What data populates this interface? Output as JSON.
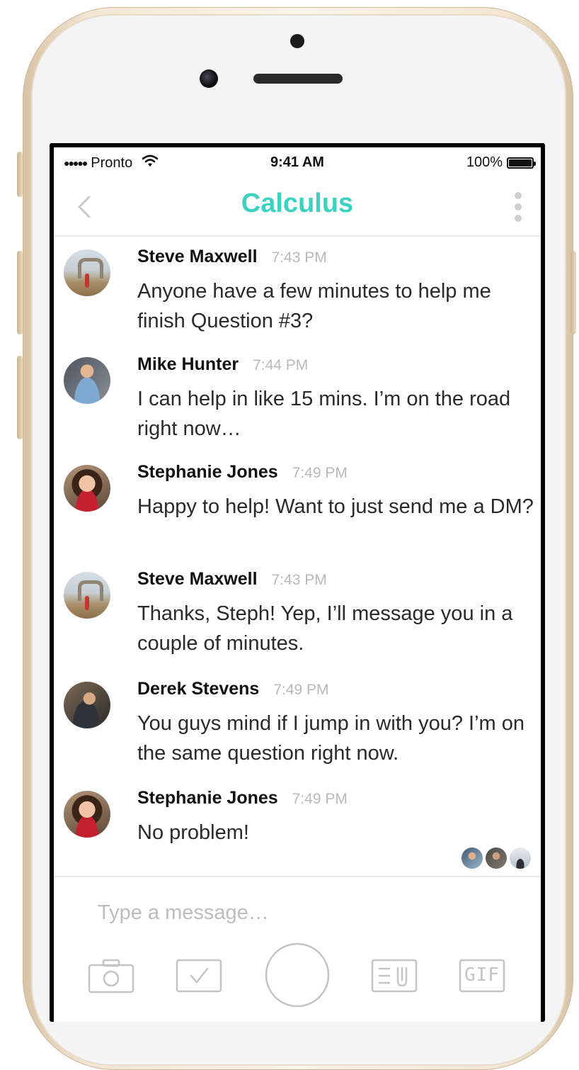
{
  "status_bar": {
    "carrier": "Pronto",
    "time": "9:41 AM",
    "battery": "100%"
  },
  "nav": {
    "title": "Calculus",
    "title_color": "#3cd2c0"
  },
  "messages": [
    {
      "sender": "Steve Maxwell",
      "time": "7:43 PM",
      "text": "Anyone have a few minutes to help me finish Question #3?"
    },
    {
      "sender": "Mike Hunter",
      "time": "7:44 PM",
      "text": "I can help in like 15 mins. I’m on the road right now…"
    },
    {
      "sender": "Stephanie Jones",
      "time": "7:49 PM",
      "text": "Happy to help! Want to just send me a DM?"
    },
    {
      "sender": "Steve Maxwell",
      "time": "7:43 PM",
      "text": "Thanks, Steph! Yep, I’ll message you in a couple of minutes."
    },
    {
      "sender": "Derek Stevens",
      "time": "7:49 PM",
      "text": "You guys mind if I jump in with you? I’m on the same question right now."
    },
    {
      "sender": "Stephanie Jones",
      "time": "7:49 PM",
      "text": "No problem!"
    }
  ],
  "composer": {
    "placeholder": "Type a message…",
    "gif_label": "GIF"
  },
  "icons": {
    "back": "chevron-left-icon",
    "more": "vertical-ellipsis-icon",
    "camera": "camera-icon",
    "poll": "checkbox-icon",
    "record": "record-button",
    "attachment": "file-attachment-icon",
    "gif": "gif-icon"
  },
  "colors": {
    "accent": "#3cd2c0",
    "timestamp": "#b9b9b9",
    "toolbar_icon": "#c4c4c4"
  }
}
